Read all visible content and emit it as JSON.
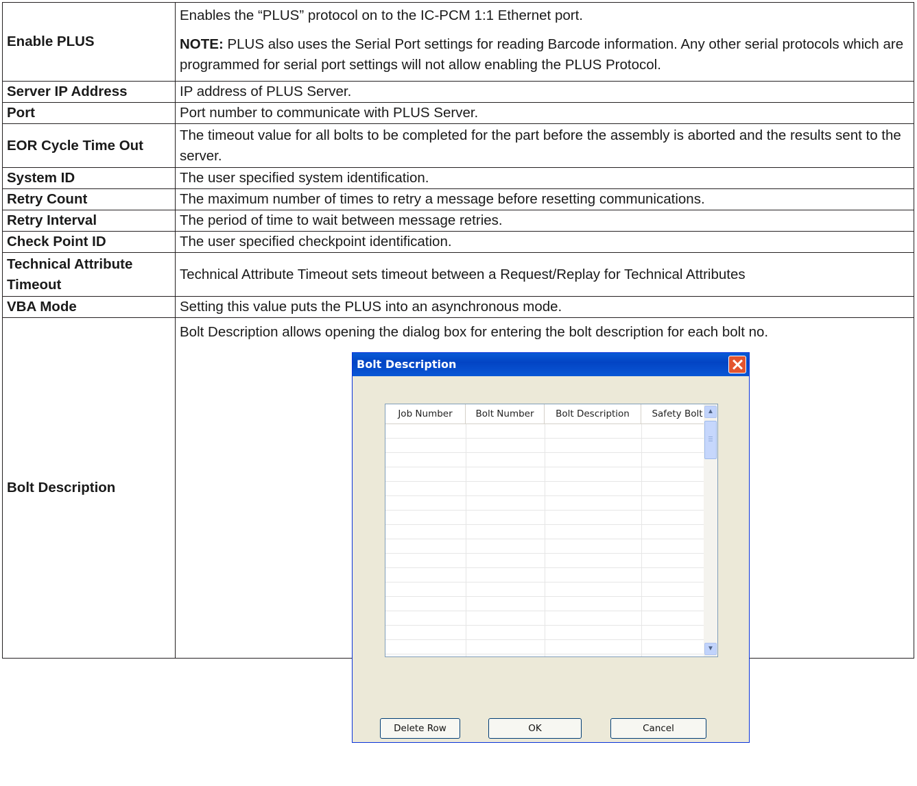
{
  "rows": [
    {
      "label": "Enable PLUS",
      "text": "Enables the “PLUS” protocol on to the IC-PCM 1:1 Ethernet port.",
      "note_label": "NOTE:",
      "note_text": " PLUS also uses the Serial Port settings for reading Barcode information. Any other serial protocols which are programmed for serial port settings will not allow enabling the PLUS Protocol."
    },
    {
      "label": "Server IP Address",
      "text": "IP address of PLUS Server."
    },
    {
      "label": "Port",
      "text": "Port number to communicate with PLUS Server."
    },
    {
      "label": "EOR Cycle Time Out",
      "text": "The timeout value for all bolts to be completed for the part before the assembly is aborted and the results sent to the server."
    },
    {
      "label": "System ID",
      "text": "The user specified system identification."
    },
    {
      "label": "Retry Count",
      "text": "The maximum number of times to retry a message before resetting communications."
    },
    {
      "label": "Retry Interval",
      "text": "The period of time to wait between message retries."
    },
    {
      "label": "Check Point ID",
      "text": "The user specified checkpoint identification."
    },
    {
      "label": "Technical Attribute Timeout",
      "text": "Technical Attribute Timeout sets timeout between a Request/Replay for Technical Attributes"
    },
    {
      "label": "VBA Mode",
      "text": "Setting this value puts the PLUS into an asynchronous mode."
    },
    {
      "label": "Bolt Description",
      "text": "Bolt Description allows opening the dialog box for entering the bolt description for each bolt no."
    }
  ],
  "dialog": {
    "title": "Bolt Description",
    "columns": [
      "Job Number",
      "Bolt Number",
      "Bolt Description",
      "Safety Bolt"
    ],
    "buttons": {
      "delete": "Delete Row",
      "ok": "OK",
      "cancel": "Cancel"
    }
  }
}
